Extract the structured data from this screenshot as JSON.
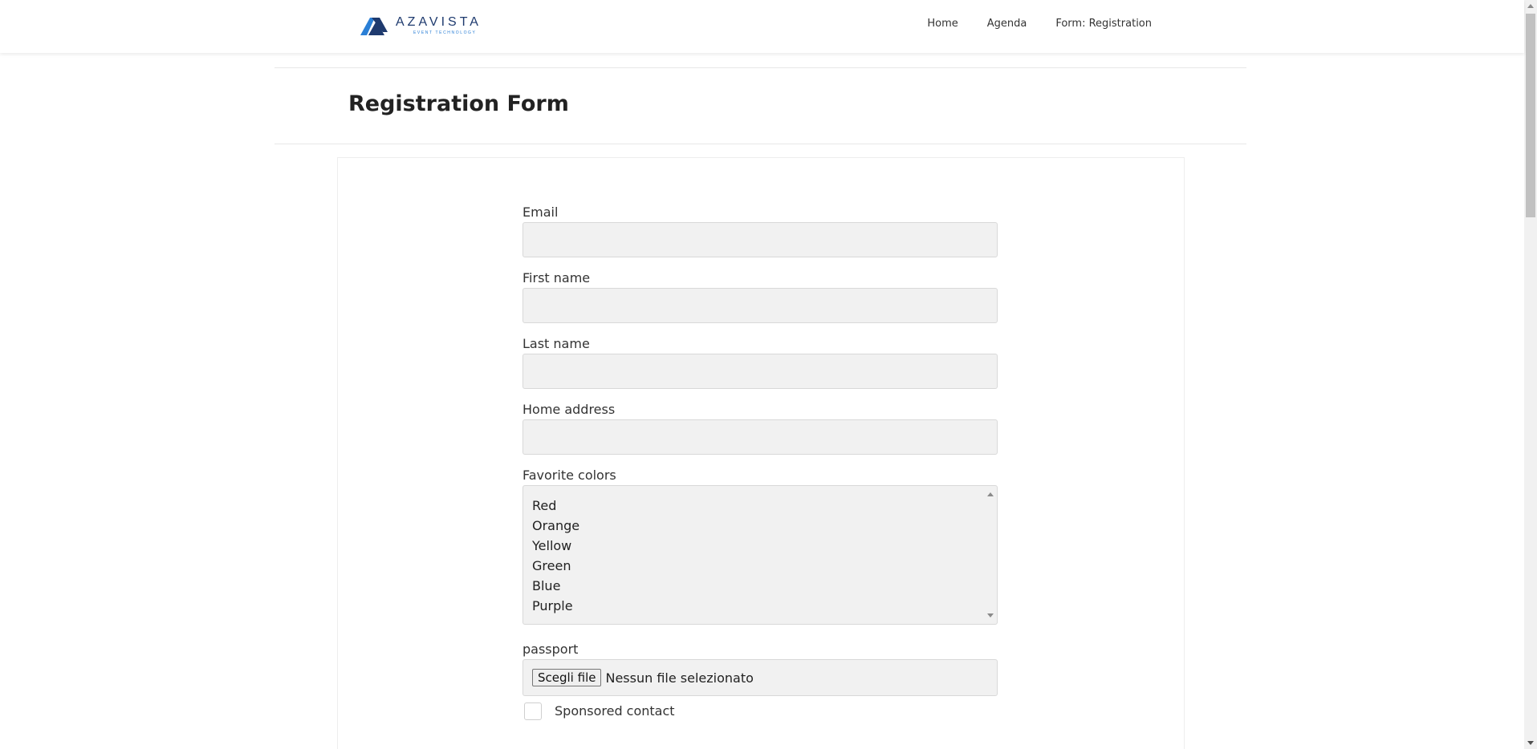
{
  "header": {
    "logo": {
      "name": "AZAVISTA",
      "tagline": "EVENT TECHNOLOGY",
      "colors": {
        "primary": "#1e3a6e",
        "accent": "#2a7fd6"
      }
    },
    "nav": [
      {
        "label": "Home"
      },
      {
        "label": "Agenda"
      },
      {
        "label": "Form: Registration"
      }
    ]
  },
  "page": {
    "title": "Registration Form"
  },
  "form": {
    "email": {
      "label": "Email",
      "value": ""
    },
    "first_name": {
      "label": "First name",
      "value": ""
    },
    "last_name": {
      "label": "Last name",
      "value": ""
    },
    "home_address": {
      "label": "Home address",
      "value": ""
    },
    "favorite_colors": {
      "label": "Favorite colors",
      "options": [
        "Red",
        "Orange",
        "Yellow",
        "Green",
        "Blue",
        "Purple"
      ]
    },
    "passport": {
      "label": "passport",
      "button_label": "Scegli file",
      "status": "Nessun file selezionato"
    },
    "sponsored_contact": {
      "label": "Sponsored contact",
      "checked": false
    }
  },
  "theme": {
    "input_background": "#f1f1f1",
    "border": "#d8d8d8"
  }
}
